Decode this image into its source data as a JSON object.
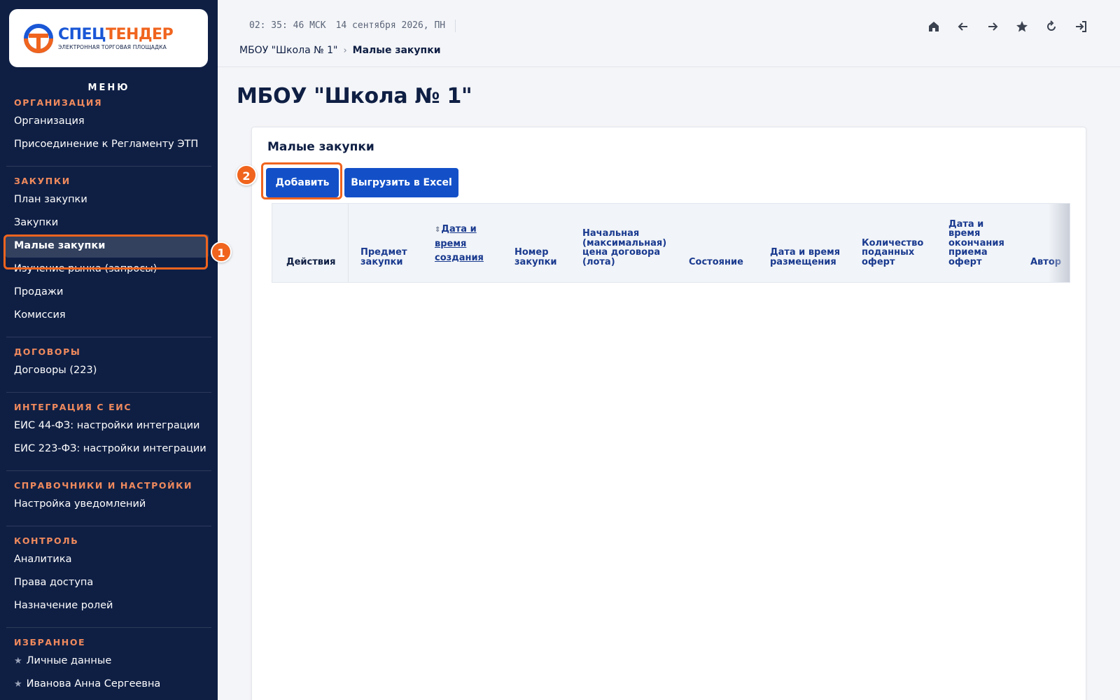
{
  "logo": {
    "title_part1": "СПЕЦ",
    "title_part2": "ТЕНДЕР",
    "subtitle": "ЭЛЕКТРОННАЯ ТОРГОВАЯ ПЛОЩАДКА",
    "colors": {
      "blue": "#1a57d6",
      "orange": "#f0641e"
    }
  },
  "sidebar": {
    "menu_title": "МЕНЮ",
    "sections": [
      {
        "title": "ОРГАНИЗАЦИЯ",
        "items": [
          "Организация",
          "Присоединение к Регламенту ЭТП"
        ]
      },
      {
        "title": "ЗАКУПКИ",
        "items": [
          "План закупки",
          "Закупки",
          "Малые закупки",
          "Изучение рынка (запросы)",
          "Продажи",
          "Комиссия"
        ]
      },
      {
        "title": "ДОГОВОРЫ",
        "items": [
          "Договоры (223)"
        ]
      },
      {
        "title": "ИНТЕГРАЦИЯ С ЕИС",
        "items": [
          "ЕИС 44-ФЗ: настройки интеграции",
          "ЕИС 223-ФЗ: настройки интеграции"
        ]
      },
      {
        "title": "СПРАВОЧНИКИ И НАСТРОЙКИ",
        "items": [
          "Настройка уведомлений"
        ]
      },
      {
        "title": "КОНТРОЛЬ",
        "items": [
          "Аналитика",
          "Права доступа",
          "Назначение ролей"
        ]
      },
      {
        "title": "ИЗБРАННОЕ",
        "items": [
          "Личные данные",
          "Иванова Анна Сергеевна"
        ]
      }
    ],
    "active_item": "Малые закупки"
  },
  "topbar": {
    "time": "02: 35: 46 МСК",
    "date": "14 сентября 2026, ПН",
    "icons": [
      "home-icon",
      "arrow-left-icon",
      "arrow-right-icon",
      "star-icon",
      "refresh-icon",
      "logout-icon"
    ]
  },
  "breadcrumb": {
    "parent": "МБОУ \"Школа № 1\"",
    "separator": "›",
    "current": "Малые закупки"
  },
  "page": {
    "title": "МБОУ \"Школа № 1\""
  },
  "card": {
    "title": "Малые закупки",
    "buttons": {
      "add": "Добавить",
      "export": "Выгрузить в Excel"
    },
    "table": {
      "columns": [
        "Действия",
        "Предмет закупки",
        "Дата и время создания",
        "Номер закупки",
        "Начальная (максимальная) цена договора (лота)",
        "Состояние",
        "Дата и время размещения",
        "Количество поданных оферт",
        "Дата и время окончания приема оферт",
        "Автор"
      ]
    }
  },
  "annotations": {
    "step1": "1",
    "step2": "2",
    "color": "#f0641e"
  }
}
